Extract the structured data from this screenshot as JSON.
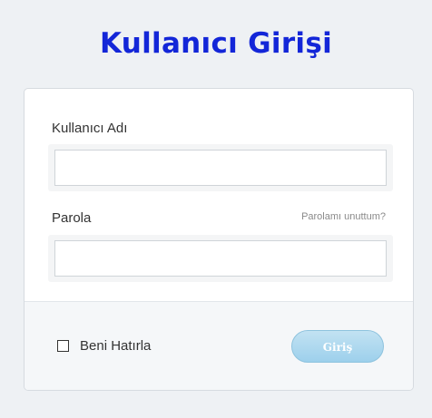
{
  "header": {
    "title": "Kullanıcı Girişi"
  },
  "form": {
    "username": {
      "label": "Kullanıcı Adı",
      "value": "",
      "placeholder": ""
    },
    "password": {
      "label": "Parola",
      "value": "",
      "placeholder": "",
      "forgot_link": "Parolamı unuttum?"
    },
    "remember_me": {
      "label": "Beni Hatırla",
      "checked": false
    },
    "submit_label": "Giriş"
  },
  "colors": {
    "title": "#1326d8",
    "button": "#a9d6ee",
    "page_background": "#eef1f4"
  }
}
